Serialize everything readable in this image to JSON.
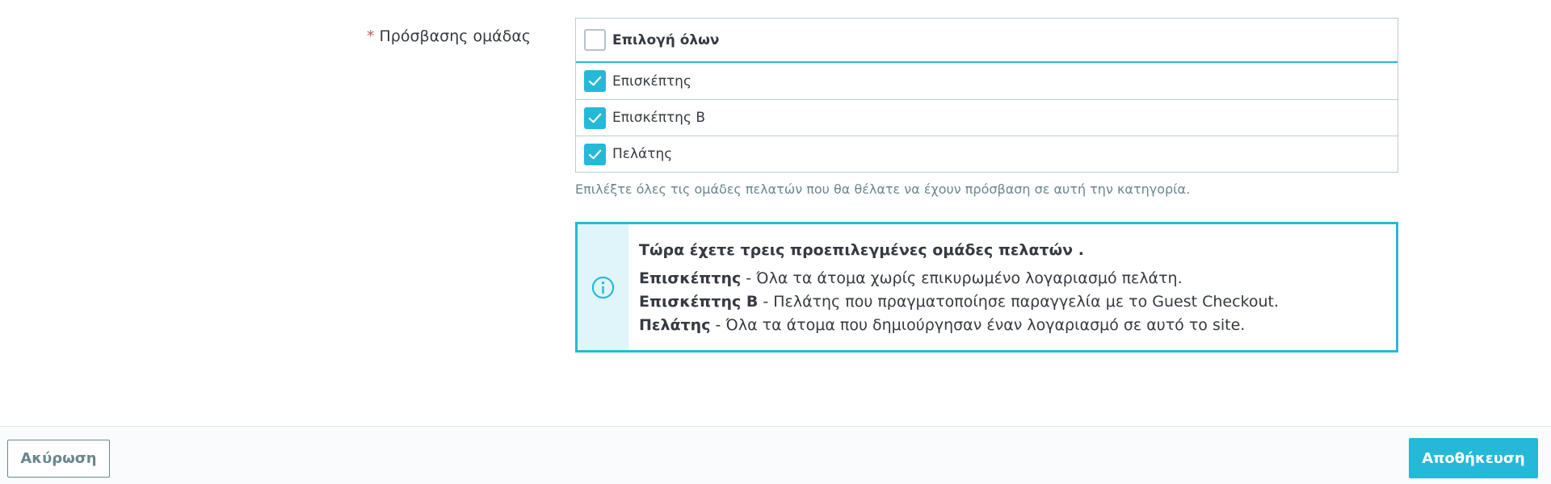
{
  "field": {
    "required_mark": "*",
    "label": "Πρόσβασης ομάδας"
  },
  "groups": {
    "select_all": {
      "label": "Επιλογή όλων",
      "checked": false
    },
    "items": [
      {
        "label": "Επισκέπτης",
        "checked": true
      },
      {
        "label": "Επισκέπτης Β",
        "checked": true
      },
      {
        "label": "Πελάτης",
        "checked": true
      }
    ],
    "help": "Επιλέξτε όλες τις ομάδες πελατών που θα θέλατε να έχουν πρόσβαση σε αυτή την κατηγορία."
  },
  "info": {
    "icon": "info-circle-icon",
    "title": "Τώρα έχετε τρεις προεπιλεγμένες ομάδες πελατών .",
    "lines": [
      {
        "name": "Επισκέπτης",
        "desc": " - Όλα τα άτομα χωρίς επικυρωμένο λογαριασμό πελάτη."
      },
      {
        "name": "Επισκέπτης Β",
        "desc": " - Πελάτης που πραγματοποίησε παραγγελία με το Guest Checkout."
      },
      {
        "name": "Πελάτης",
        "desc": " - Όλα τα άτομα που δημιούργησαν έναν λογαριασμό σε αυτό το site."
      }
    ]
  },
  "footer": {
    "cancel_label": "Ακύρωση",
    "save_label": "Αποθήκευση"
  },
  "colors": {
    "accent": "#25b9d7",
    "required": "#c05c67",
    "info_bg": "#dff5f9"
  }
}
